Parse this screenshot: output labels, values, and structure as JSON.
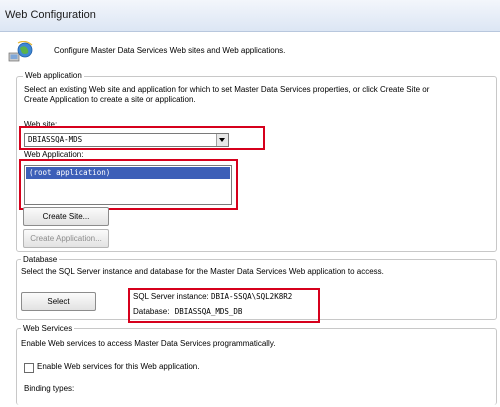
{
  "window": {
    "title": "Web Configuration"
  },
  "header": {
    "description": "Configure Master Data Services Web sites and Web applications."
  },
  "web_application": {
    "legend": "Web application",
    "description_line1": "Select an existing Web site and application for which to set Master Data Services properties, or click Create Site or",
    "description_line2": "Create Application to create a site or application.",
    "website_label": "Web site:",
    "website_value": "DBIASSQA-MDS",
    "application_label": "Web Application:",
    "applications": [
      "(root application)"
    ],
    "create_site_label": "Create Site...",
    "create_application_label": "Create Application..."
  },
  "database": {
    "legend": "Database",
    "description": "Select the SQL Server instance and database for the Master Data Services Web application to access.",
    "select_label": "Select",
    "instance_label": "SQL Server instance:",
    "instance_value": "DBIA-SSQA\\SQL2K8R2",
    "database_label": "Database:",
    "database_value": "DBIASSQA_MDS_DB"
  },
  "web_services": {
    "legend": "Web Services",
    "description": "Enable Web services to access Master Data Services programmatically.",
    "enable_label": "Enable Web services for this Web application.",
    "enable_checked": false,
    "binding_label": "Binding types:"
  }
}
